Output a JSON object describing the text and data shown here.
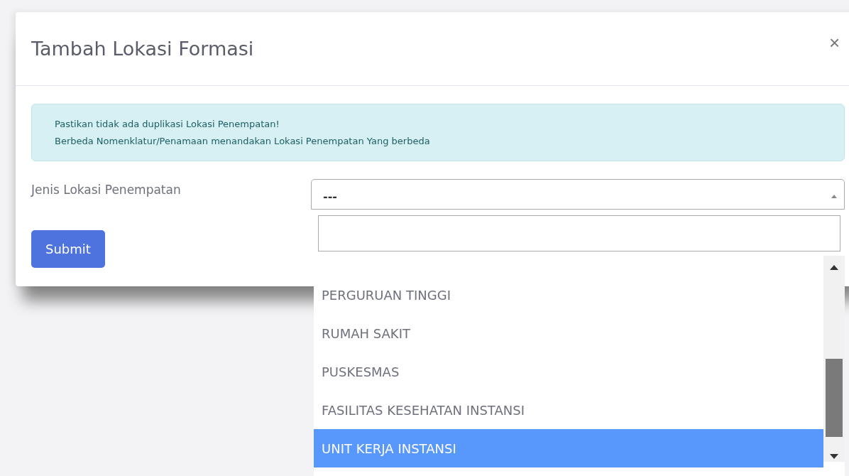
{
  "dialog": {
    "title": "Tambah Lokasi Formasi",
    "close": "×"
  },
  "alert": {
    "lines": [
      "Pastikan tidak ada duplikasi Lokasi Penempatan!",
      "Berbeda Nomenklatur/Penamaan menandakan Lokasi Penempatan Yang berbeda"
    ]
  },
  "form": {
    "label": "Jenis Lokasi Penempatan",
    "select": {
      "value": "---",
      "expanded": true
    },
    "submit": "Submit"
  },
  "dropdown": {
    "options": [
      {
        "label": "PERGURUAN TINGGI",
        "selected": false
      },
      {
        "label": "RUMAH SAKIT",
        "selected": false
      },
      {
        "label": "PUSKESMAS",
        "selected": false
      },
      {
        "label": "FASILITAS KESEHATAN INSTANSI",
        "selected": false
      },
      {
        "label": "UNIT KERJA INSTANSI",
        "selected": true
      }
    ]
  }
}
